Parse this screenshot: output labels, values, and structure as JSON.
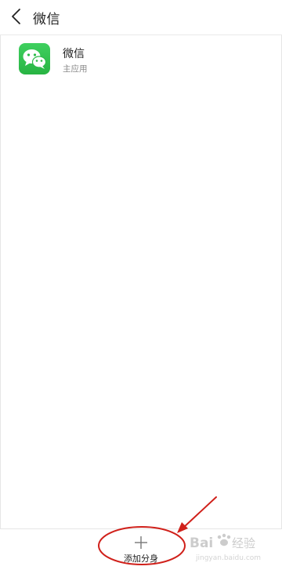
{
  "header": {
    "title": "微信",
    "back_icon": "chevron-left-icon"
  },
  "app_list": [
    {
      "name": "微信",
      "subtitle": "主应用",
      "icon": "wechat-icon",
      "icon_color": "#2dbb4a"
    }
  ],
  "bottom_bar": {
    "add_label": "添加分身",
    "add_icon": "plus-icon"
  },
  "annotation": {
    "color": "#d0201a"
  },
  "watermark": {
    "logo": "Bai度经验",
    "url": "jingyan.baidu.com"
  }
}
